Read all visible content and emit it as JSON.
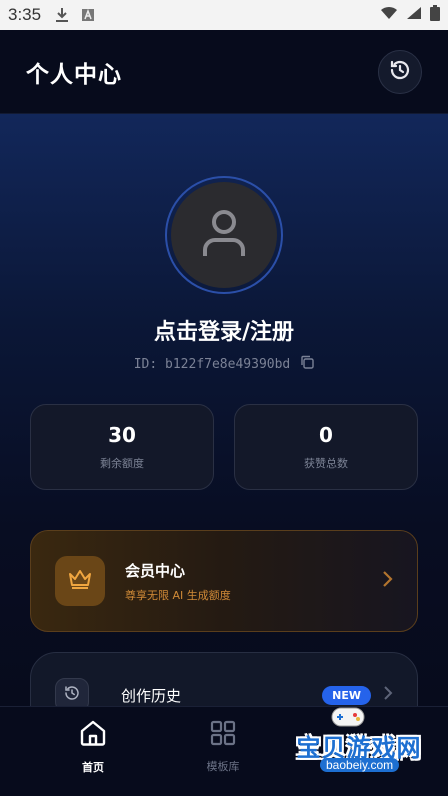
{
  "status_bar": {
    "time": "3:35"
  },
  "header": {
    "title": "个人中心"
  },
  "profile": {
    "login_text": "点击登录/注册",
    "id_text": "ID: b122f7e8e49390bd"
  },
  "stats": [
    {
      "value": "30",
      "label": "剩余额度"
    },
    {
      "value": "0",
      "label": "获赞总数"
    }
  ],
  "vip": {
    "title": "会员中心",
    "subtitle": "尊享无限 AI 生成额度"
  },
  "list": {
    "history_label": "创作历史",
    "badge": "NEW"
  },
  "nav": {
    "items": [
      {
        "label": "首页"
      },
      {
        "label": "模板库"
      }
    ]
  },
  "watermark": {
    "text": "宝贝游戏网",
    "url": "baobeiy.com"
  },
  "colors": {
    "accent": "#2563eb",
    "vip_gold": "#d08a37",
    "background": "#070b1c"
  }
}
